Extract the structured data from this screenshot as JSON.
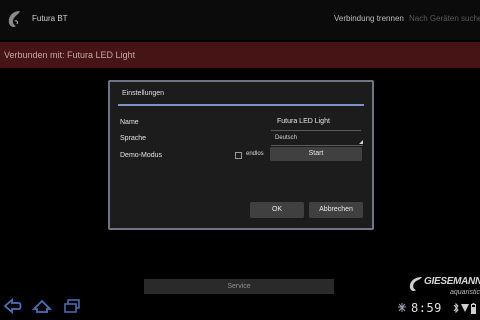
{
  "actionbar": {
    "app_title": "Futura BT",
    "disconnect_label": "Verbindung trennen",
    "search_label": "Nach Geräten suchen"
  },
  "banner": {
    "text": "Verbunden mit: Futura LED Light"
  },
  "dialog": {
    "title": "Einstellungen",
    "name_label": "Name",
    "name_value": "Futura LED Light",
    "language_label": "Sprache",
    "language_value": "Deutsch",
    "demo_label": "Demo-Modus",
    "endless_label": "endlos",
    "endless_checked": false,
    "start_label": "Start",
    "ok_label": "OK",
    "cancel_label": "Abbrechen"
  },
  "service_label": "Service",
  "logo": {
    "brand": "GIESEMANN",
    "sub": "aquaristic"
  },
  "systembar": {
    "time": "8:59"
  },
  "colors": {
    "banner_bg": "#461414",
    "dialog_accent": "#7c92c8",
    "nav_icon": "#4f6fb8"
  }
}
